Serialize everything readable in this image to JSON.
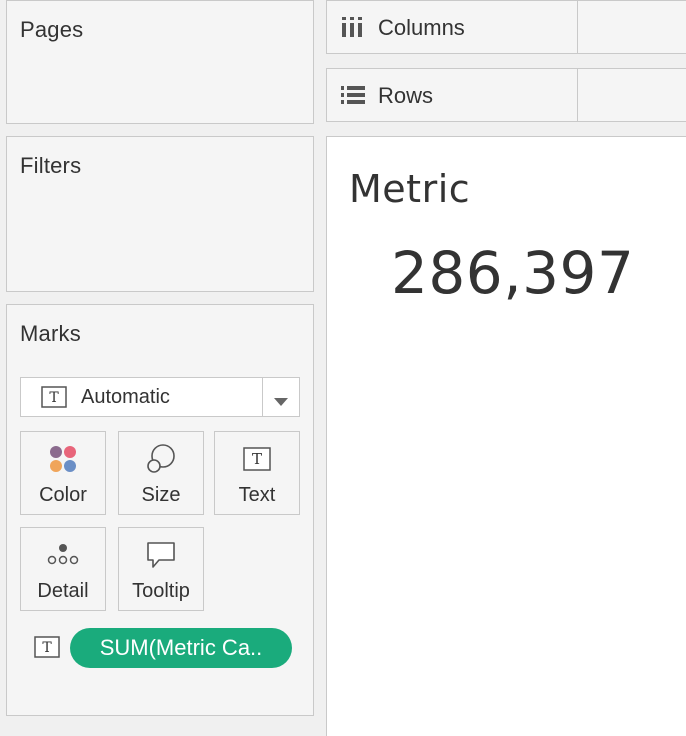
{
  "left_pane": {
    "pages": {
      "title": "Pages"
    },
    "filters": {
      "title": "Filters"
    },
    "marks": {
      "title": "Marks",
      "mark_type": {
        "value": "Automatic",
        "icon": "text-mark-icon"
      },
      "buttons": [
        {
          "label": "Color",
          "icon": "color-dots-icon"
        },
        {
          "label": "Size",
          "icon": "size-circles-icon"
        },
        {
          "label": "Text",
          "icon": "text-mark-icon"
        },
        {
          "label": "Detail",
          "icon": "detail-dots-icon"
        },
        {
          "label": "Tooltip",
          "icon": "speech-bubble-icon"
        }
      ],
      "field_pill": {
        "label": "SUM(Metric Ca..",
        "icon": "text-mark-icon",
        "color": "#1aab7c"
      }
    }
  },
  "shelves": {
    "columns": {
      "label": "Columns",
      "icon": "columns-bars-icon"
    },
    "rows": {
      "label": "Rows",
      "icon": "rows-list-icon"
    }
  },
  "view": {
    "header": "Metric",
    "value": "286,397"
  },
  "colors": {
    "pane_background": "#f5f5f5",
    "border": "#c9c9c9",
    "pill_green": "#1aab7c",
    "color_dots": [
      "#8b6b8e",
      "#e8657a",
      "#f0a55a",
      "#6b8fc6"
    ]
  }
}
